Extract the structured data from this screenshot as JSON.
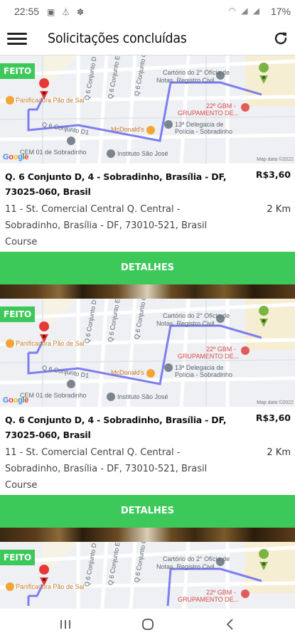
{
  "status_bar": {
    "time": "22:55",
    "notification_icons": "▣ ⏃ ✽",
    "signal_icons": "◠ ◢ ◢",
    "battery": "17%"
  },
  "app_bar": {
    "title": "Solicitações concluídas"
  },
  "map_labels": {
    "cartorio_1": "Cartório do 2° Ofício de",
    "cartorio_2": "Notas, Registro Civil...",
    "panificadora": "Panificadora Pão de Sal",
    "mcdonalds": "McDonald's",
    "gbm_1": "22º GBM -",
    "gbm_2": "GRUPAMENTO DE...",
    "delegacia_1": "13ª Delegacia de",
    "delegacia_2": "Polícia - Sobradinho",
    "cem": "CEM 01 de Sobradinho",
    "instituto": "Instituto São José",
    "street_q6_a": "Q 6 Conjunto D",
    "street_q6_b": "Q 6 Conjunto E",
    "street_q6_c": "Q 6 Conjunto C",
    "street_q6_d": "Q 6 Conjunto D1",
    "google": "Google",
    "map_data": "Map data ©2022"
  },
  "requests": [
    {
      "status": "FEITO",
      "origin": "Q. 6 Conjunto D, 4 - Sobradinho, Brasília - DF, 73025-060, Brasil",
      "price": "R$3,60",
      "destination": "11 - St. Comercial Central Q. Central - Sobradinho, Brasília - DF, 73010-521, Brasil",
      "destination_suffix": "Course",
      "distance": "2 Km",
      "details_label": "DETALHES"
    },
    {
      "status": "FEITO",
      "origin": "Q. 6 Conjunto D, 4 - Sobradinho, Brasília - DF, 73025-060, Brasil",
      "price": "R$3,60",
      "destination": "11 - St. Comercial Central Q. Central - Sobradinho, Brasília - DF, 73010-521, Brasil",
      "destination_suffix": "Course",
      "distance": "2 Km",
      "details_label": "DETALHES"
    },
    {
      "status": "FEITO"
    }
  ],
  "colors": {
    "accent_green": "#3cc95a",
    "route": "#7d7df0",
    "origin_pin": "#e53935",
    "destination_pin": "#7cb342"
  },
  "icons": {
    "menu": "menu-icon",
    "refresh": "refresh-icon",
    "back": "back-icon",
    "home": "home-icon",
    "recents": "recents-icon"
  }
}
